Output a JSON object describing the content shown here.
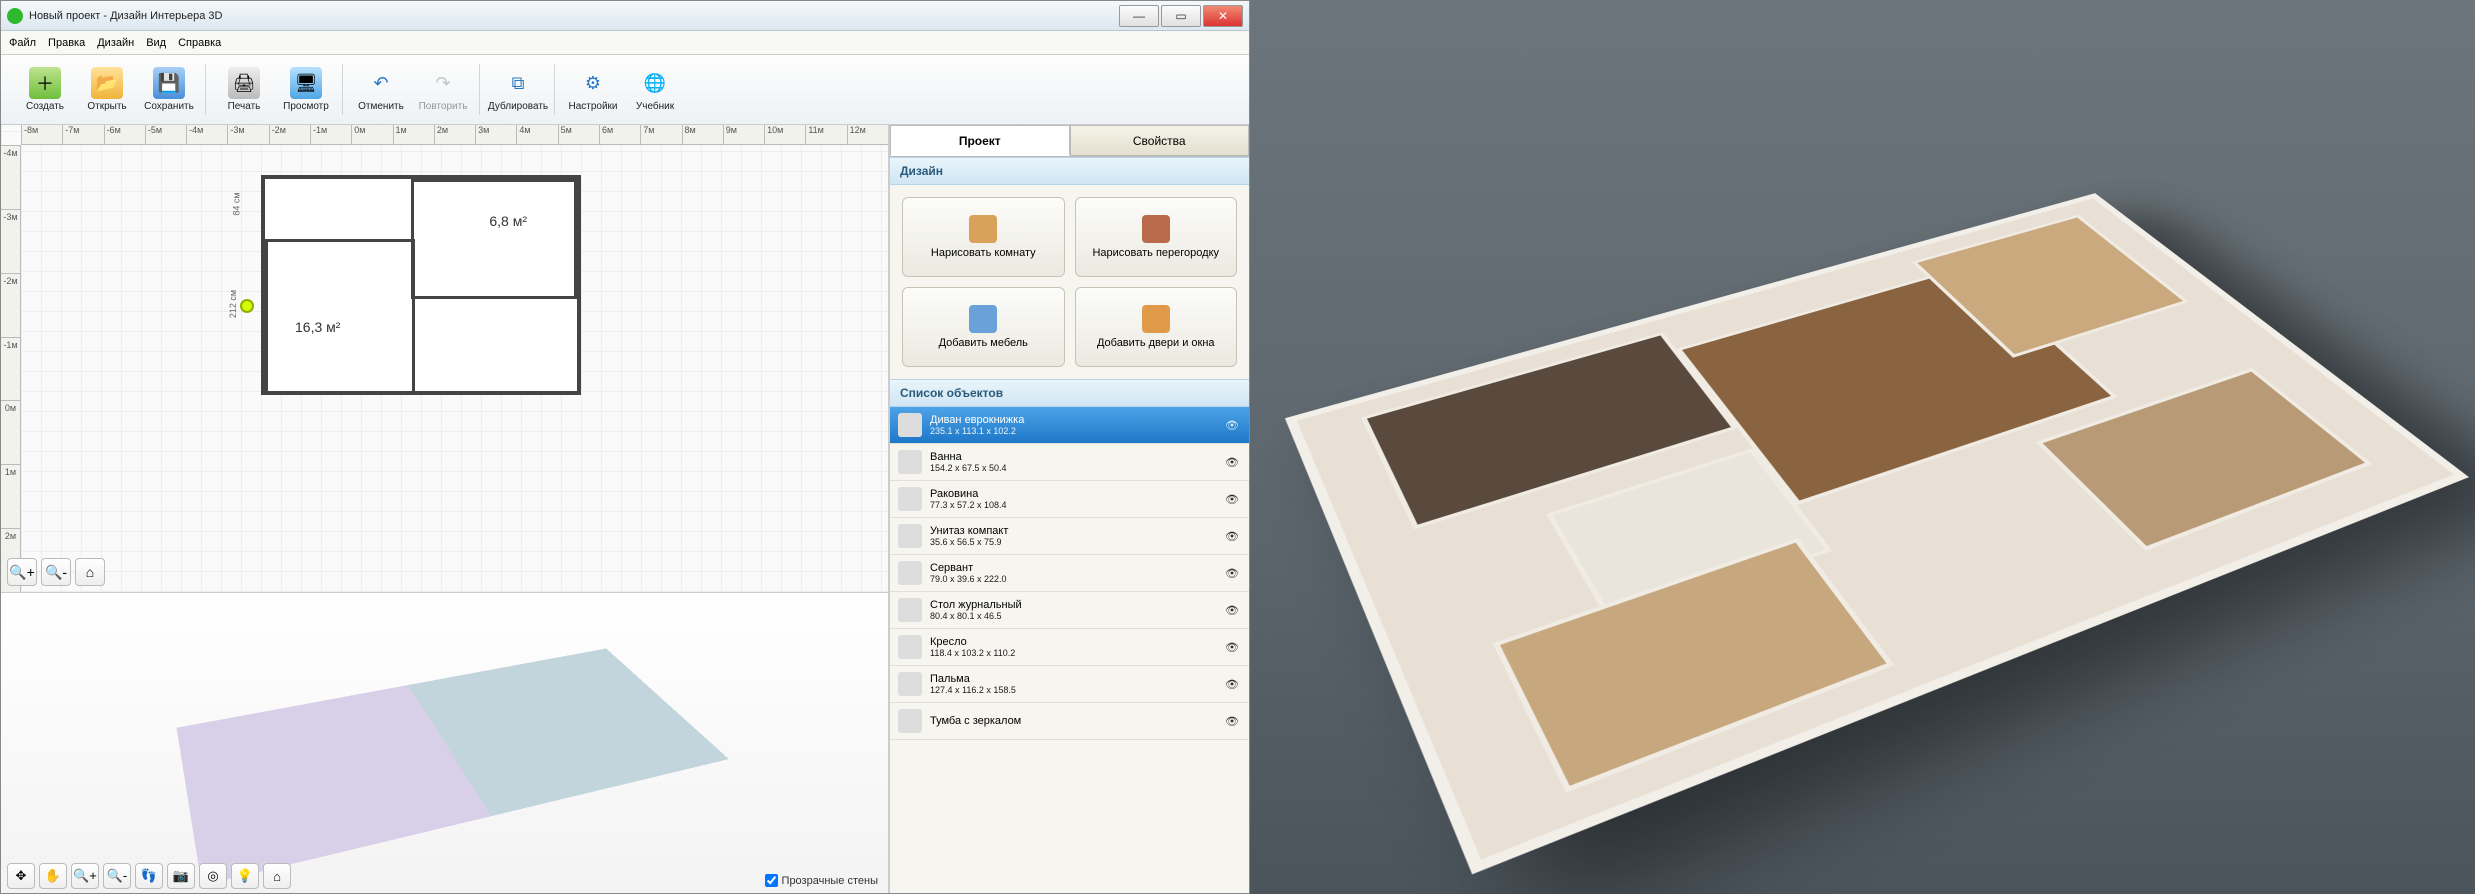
{
  "window": {
    "title": "Новый проект - Дизайн Интерьера 3D"
  },
  "menu": {
    "items": [
      "Файл",
      "Правка",
      "Дизайн",
      "Вид",
      "Справка"
    ]
  },
  "toolbar": {
    "create": "Создать",
    "open": "Открыть",
    "save": "Сохранить",
    "print": "Печать",
    "preview": "Просмотр",
    "undo": "Отменить",
    "redo": "Повторить",
    "duplicate": "Дублировать",
    "settings": "Настройки",
    "tutorial": "Учебник"
  },
  "ruler": {
    "horizontal": [
      "-8м",
      "-7м",
      "-6м",
      "-5м",
      "-4м",
      "-3м",
      "-2м",
      "-1м",
      "0м",
      "1м",
      "2м",
      "3м",
      "4м",
      "5м",
      "6м",
      "7м",
      "8м",
      "9м",
      "10м",
      "11м",
      "12м"
    ],
    "vertical": [
      "-4м",
      "-3м",
      "-2м",
      "-1м",
      "0м",
      "1м",
      "2м"
    ]
  },
  "floorplan": {
    "area1": "16,3 м²",
    "area2": "6,8 м²",
    "dim_horizontal": "84 см",
    "dim_vertical": "212 см"
  },
  "tabs": {
    "project": "Проект",
    "properties": "Свойства"
  },
  "side": {
    "design_header": "Дизайн",
    "objects_header": "Список объектов",
    "draw_room": "Нарисовать комнату",
    "draw_partition": "Нарисовать перегородку",
    "add_furniture": "Добавить мебель",
    "add_doors": "Добавить двери и окна"
  },
  "objects": [
    {
      "name": "Диван еврокнижка",
      "dims": "235.1 x 113.1 x 102.2",
      "selected": true
    },
    {
      "name": "Ванна",
      "dims": "154.2 x 67.5 x 50.4",
      "selected": false
    },
    {
      "name": "Раковина",
      "dims": "77.3 x 57.2 x 108.4",
      "selected": false
    },
    {
      "name": "Унитаз компакт",
      "dims": "35.6 x 56.5 x 75.9",
      "selected": false
    },
    {
      "name": "Сервант",
      "dims": "79.0 x 39.6 x 222.0",
      "selected": false
    },
    {
      "name": "Стол журнальный",
      "dims": "80.4 x 80.1 x 46.5",
      "selected": false
    },
    {
      "name": "Кресло",
      "dims": "118.4 x 103.2 x 110.2",
      "selected": false
    },
    {
      "name": "Пальма",
      "dims": "127.4 x 116.2 x 158.5",
      "selected": false
    },
    {
      "name": "Тумба с зеркалом",
      "dims": "",
      "selected": false
    }
  ],
  "footer": {
    "transparent_walls": "Прозрачные стены"
  }
}
